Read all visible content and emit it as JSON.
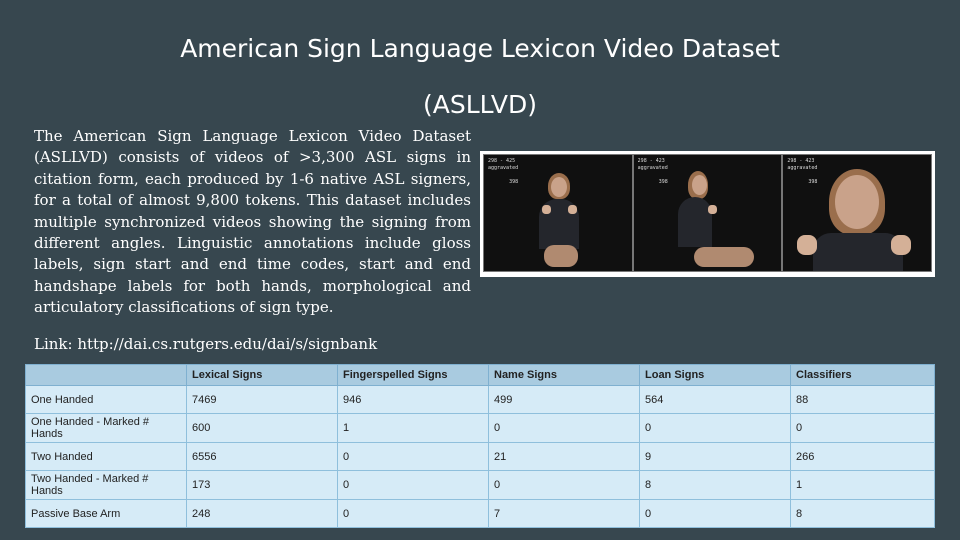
{
  "title": {
    "line1": "American Sign Language Lexicon Video Dataset",
    "line2": "(ASLLVD)"
  },
  "description": "The American Sign Language Lexicon Video Dataset (ASLLVD) consists of videos of >3,300 ASL signs in citation form, each produced by 1-6 native ASL signers, for a total of almost 9,800 tokens. This dataset includes multiple synchronized videos showing the signing from different angles. Linguistic annotations include gloss labels, sign start and end time codes, start and end handshape labels for both hands, morphological and articulatory classifications of sign type.",
  "link": "Link: http://dai.cs.rutgers.edu/dai/s/signbank",
  "video_frames": [
    {
      "overlay": "298 - 425\naggravated\n\n       398"
    },
    {
      "overlay": "298 - 423\naggravated\n\n       398"
    },
    {
      "overlay": "298 - 423\naggravated\n\n       398"
    }
  ],
  "table": {
    "headers": [
      "",
      "Lexical Signs",
      "Fingerspelled Signs",
      "Name Signs",
      "Loan Signs",
      "Classifiers"
    ],
    "rows": [
      [
        "One Handed",
        "7469",
        "946",
        "499",
        "564",
        "88"
      ],
      [
        "One Handed - Marked # Hands",
        "600",
        "1",
        "0",
        "0",
        "0"
      ],
      [
        "Two Handed",
        "6556",
        "0",
        "21",
        "9",
        "266"
      ],
      [
        "Two Handed - Marked # Hands",
        "173",
        "0",
        "0",
        "8",
        "1"
      ],
      [
        "Passive Base Arm",
        "248",
        "0",
        "7",
        "0",
        "8"
      ]
    ]
  }
}
